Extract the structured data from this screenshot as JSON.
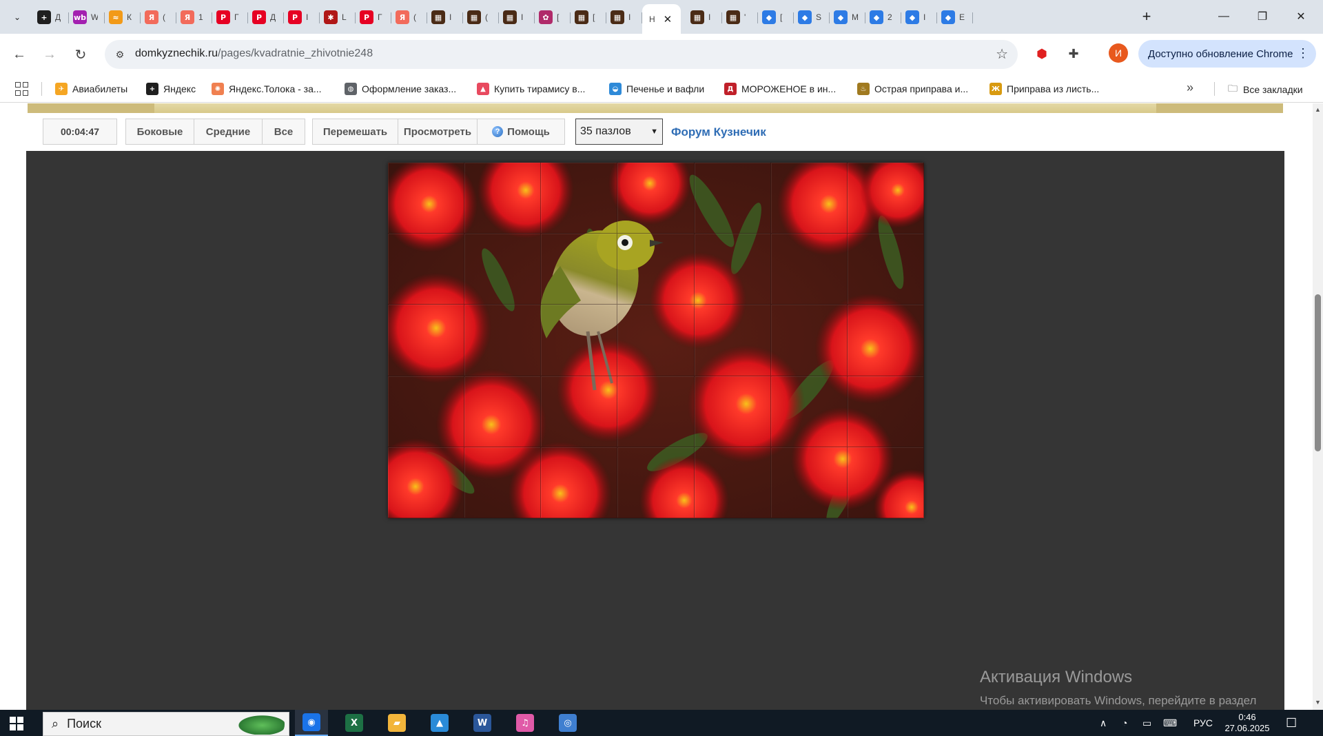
{
  "browser": {
    "tabs": [
      {
        "favicon": "plus-icon",
        "color": "#1f1f1f",
        "glyph": "+",
        "letter": "Д"
      },
      {
        "favicon": "wb-icon",
        "color": "#a320b0",
        "glyph": "wb",
        "letter": "W"
      },
      {
        "favicon": "flame-icon",
        "color": "#f29a18",
        "glyph": "≈",
        "letter": "К"
      },
      {
        "favicon": "yandex-icon",
        "color": "#f26b5b",
        "glyph": "Я",
        "letter": "("
      },
      {
        "favicon": "yandex-icon",
        "color": "#f26b5b",
        "glyph": "Я",
        "letter": "1"
      },
      {
        "favicon": "pinterest-icon",
        "color": "#e60023",
        "glyph": "P",
        "letter": "Г"
      },
      {
        "favicon": "pinterest-icon",
        "color": "#e60023",
        "glyph": "P",
        "letter": "Д"
      },
      {
        "favicon": "pinterest-icon",
        "color": "#e60023",
        "glyph": "P",
        "letter": "I"
      },
      {
        "favicon": "grasshopper-icon",
        "color": "#b01717",
        "glyph": "✱",
        "letter": "L"
      },
      {
        "favicon": "pinterest-icon",
        "color": "#e60023",
        "glyph": "P",
        "letter": "Г"
      },
      {
        "favicon": "yandex-icon",
        "color": "#f26b5b",
        "glyph": "Я",
        "letter": "("
      },
      {
        "favicon": "photo-icon",
        "color": "#4a2b16",
        "glyph": "▦",
        "letter": "I"
      },
      {
        "favicon": "photo-icon",
        "color": "#4a2b16",
        "glyph": "▦",
        "letter": "("
      },
      {
        "favicon": "photo-icon",
        "color": "#4a2b16",
        "glyph": "▦",
        "letter": "I"
      },
      {
        "favicon": "art-icon",
        "color": "#b02a6a",
        "glyph": "✿",
        "letter": "["
      },
      {
        "favicon": "photo-icon",
        "color": "#4a2b16",
        "glyph": "▦",
        "letter": "["
      },
      {
        "favicon": "photo-icon",
        "color": "#4a2b16",
        "glyph": "▦",
        "letter": "I"
      },
      {
        "favicon": "page-icon",
        "color": "#ffffff",
        "glyph": "",
        "letter": "Н",
        "active": true
      },
      {
        "favicon": "photo-icon",
        "color": "#4a2b16",
        "glyph": "▦",
        "letter": "I"
      },
      {
        "favicon": "photo-icon",
        "color": "#4a2b16",
        "glyph": "▦",
        "letter": "'"
      },
      {
        "favicon": "tile-icon",
        "color": "#2d7be5",
        "glyph": "◆",
        "letter": "["
      },
      {
        "favicon": "tile-icon",
        "color": "#2d7be5",
        "glyph": "◆",
        "letter": "S"
      },
      {
        "favicon": "tile-icon",
        "color": "#2d7be5",
        "glyph": "◆",
        "letter": "M"
      },
      {
        "favicon": "tile-icon",
        "color": "#2d7be5",
        "glyph": "◆",
        "letter": "2"
      },
      {
        "favicon": "tile-icon",
        "color": "#2d7be5",
        "glyph": "◆",
        "letter": "I"
      },
      {
        "favicon": "tile-icon",
        "color": "#2d7be5",
        "glyph": "◆",
        "letter": "E"
      }
    ],
    "url_host": "domkyznechik.ru",
    "url_path": "/pages/kvadratnie_zhivotnie248",
    "profile_initial": "И",
    "update_label": "Доступно обновление Chrome",
    "accent": "#d3e3fd"
  },
  "bookmarks": {
    "items": [
      {
        "label": "Авиабилеты",
        "icon": "plane-icon",
        "color": "#f5a623",
        "glyph": "✈"
      },
      {
        "label": "Яндекс",
        "icon": "yandex-plus-icon",
        "color": "#1f1f1f",
        "glyph": "+"
      },
      {
        "label": "Яндекс.Толока - за...",
        "icon": "toloka-icon",
        "color": "#f08050",
        "glyph": "✺"
      },
      {
        "label": "Оформление заказ...",
        "icon": "globe-icon",
        "color": "#5f6368",
        "glyph": "◍"
      },
      {
        "label": "Купить тирамису в...",
        "icon": "cake-icon",
        "color": "#e84a5f",
        "glyph": "▲"
      },
      {
        "label": "Печенье и вафли",
        "icon": "basket-icon",
        "color": "#2e8ad8",
        "glyph": "◒"
      },
      {
        "label": "МОРОЖЕНОЕ в ин...",
        "icon": "d-icon",
        "color": "#c0202a",
        "glyph": "Д"
      },
      {
        "label": "Острая приправа и...",
        "icon": "pepper-icon",
        "color": "#a07a20",
        "glyph": "♨"
      },
      {
        "label": "Приправа из листь...",
        "icon": "spice-icon",
        "color": "#d89a10",
        "glyph": "Ж"
      }
    ],
    "all_label": "Все закладки"
  },
  "puzzle": {
    "timer": "00:04:47",
    "filters": [
      "Боковые",
      "Средние",
      "Все"
    ],
    "shuffle_label": "Перемешать",
    "preview_label": "Просмотреть",
    "help_label": "Помощь",
    "pieces_select": "35 пазлов",
    "forum_link": "Форум Кузнечик",
    "grid": {
      "columns": 7,
      "rows": 5
    },
    "link_color": "#2f6db5"
  },
  "watermark": {
    "title": "Активация Windows",
    "text": "Чтобы активировать Windows, перейдите в раздел \"Параметры\"."
  },
  "scroll": {
    "position_fraction": 0.42,
    "visible_fraction": 0.27
  },
  "taskbar": {
    "search_placeholder": "Поиск",
    "apps": [
      {
        "name": "chrome-app",
        "color": "#1a73e8",
        "glyph": "◉",
        "active": true
      },
      {
        "name": "excel-app",
        "color": "#1d7044",
        "glyph": "X"
      },
      {
        "name": "explorer-app",
        "color": "#f2b53b",
        "glyph": "▰"
      },
      {
        "name": "photos-app",
        "color": "#2a8bd8",
        "glyph": "▲"
      },
      {
        "name": "word-app",
        "color": "#2b579a",
        "glyph": "W"
      },
      {
        "name": "itunes-app",
        "color": "#e05aa8",
        "glyph": "♫"
      },
      {
        "name": "spiral-app",
        "color": "#3f7fd0",
        "glyph": "◎"
      }
    ],
    "language": "РУС",
    "time": "0:46",
    "date": "27.06.2025"
  }
}
